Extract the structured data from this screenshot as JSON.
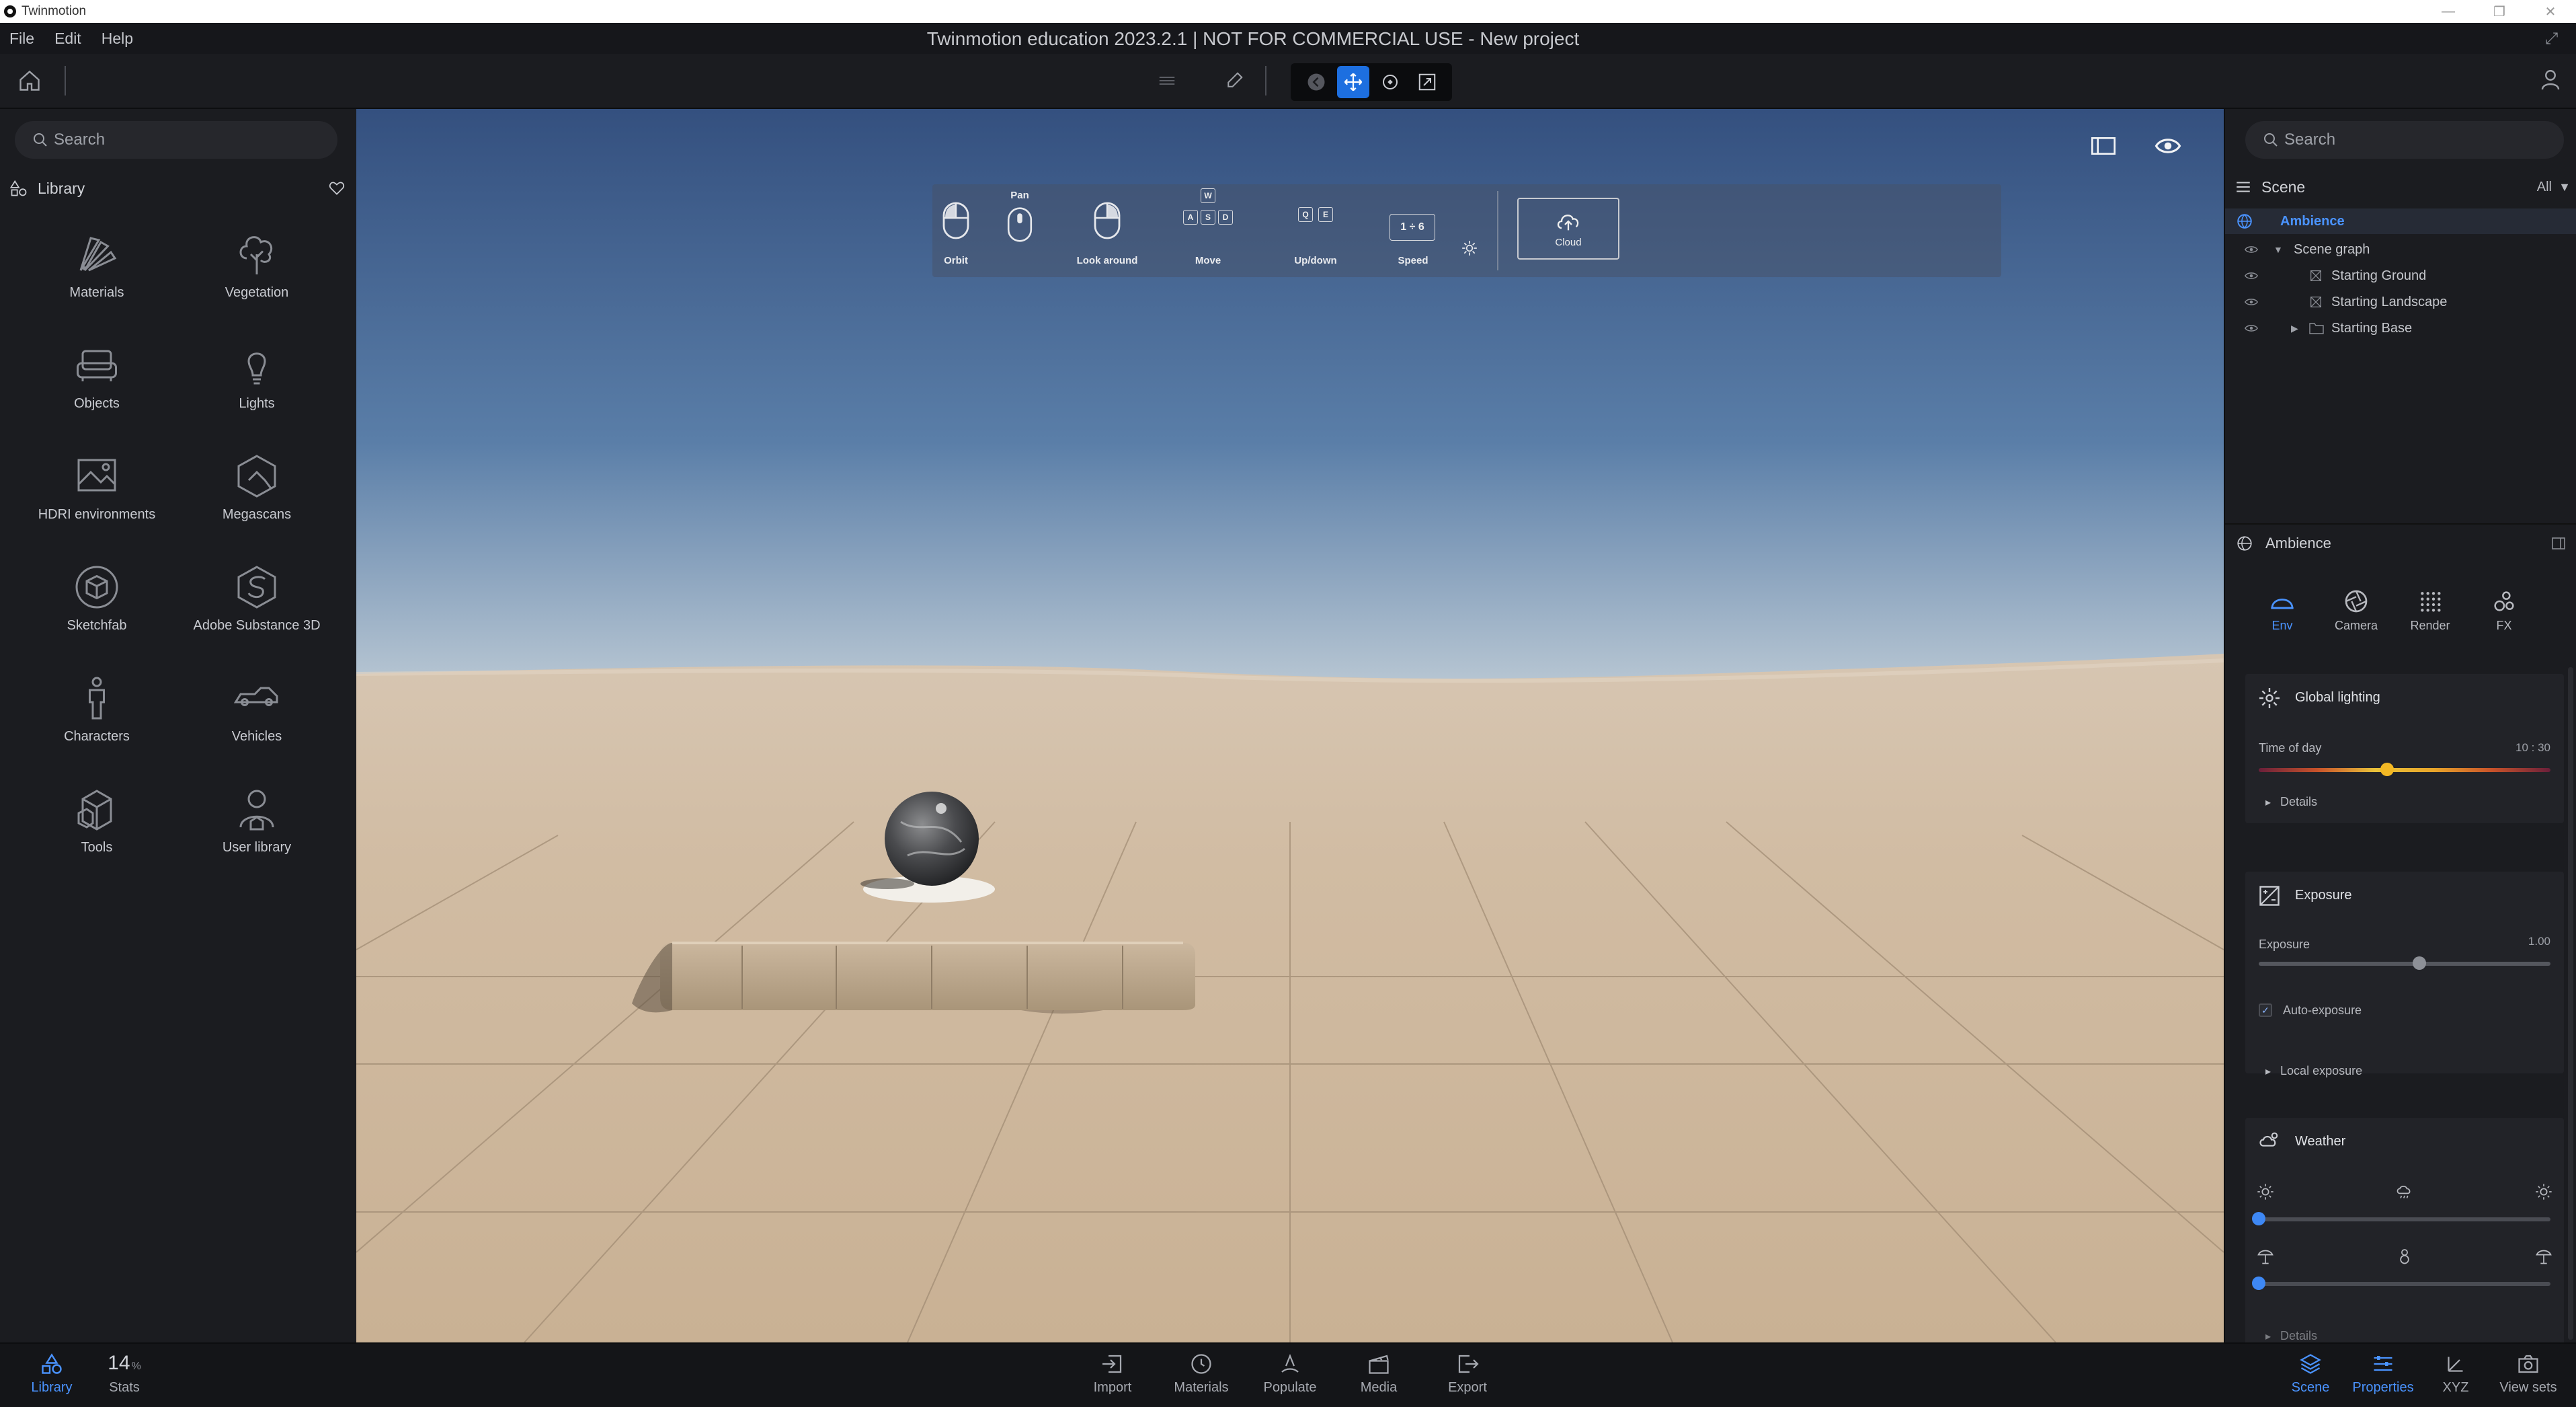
{
  "os": {
    "app_name": "Twinmotion"
  },
  "app": {
    "menus": [
      "File",
      "Edit",
      "Help"
    ],
    "title": "Twinmotion education 2023.2.1 | NOT FOR COMMERCIAL USE - New project"
  },
  "left_panel": {
    "search_placeholder": "Search",
    "library_label": "Library",
    "items": [
      {
        "label": "Materials",
        "icon": "materials-icon"
      },
      {
        "label": "Vegetation",
        "icon": "tree-icon"
      },
      {
        "label": "Objects",
        "icon": "sofa-icon"
      },
      {
        "label": "Lights",
        "icon": "bulb-icon"
      },
      {
        "label": "HDRI environments",
        "icon": "hdri-icon"
      },
      {
        "label": "Megascans",
        "icon": "megascans-icon"
      },
      {
        "label": "Sketchfab",
        "icon": "sketchfab-icon"
      },
      {
        "label": "Adobe Substance 3D",
        "icon": "substance-icon"
      },
      {
        "label": "Characters",
        "icon": "person-icon"
      },
      {
        "label": "Vehicles",
        "icon": "car-icon"
      },
      {
        "label": "Tools",
        "icon": "cubes-icon"
      },
      {
        "label": "User library",
        "icon": "user-library-icon"
      }
    ]
  },
  "nav_help": {
    "orbit": "Orbit",
    "pan": "Pan",
    "look_around": "Look around",
    "move": "Move",
    "updown": "Up/down",
    "speed": "Speed",
    "speed_keys": "1 ÷ 6",
    "cloud": "Cloud",
    "keys_move": [
      "W",
      "A",
      "S",
      "D"
    ],
    "keys_updown": [
      "Q",
      "E"
    ]
  },
  "right_panel": {
    "search_placeholder": "Search",
    "scene_label": "Scene",
    "filter": "All",
    "tree": [
      {
        "label": "Ambience"
      },
      {
        "label": "Scene graph"
      },
      {
        "label": "Starting Ground"
      },
      {
        "label": "Starting Landscape"
      },
      {
        "label": "Starting Base"
      }
    ],
    "ambience_label": "Ambience",
    "tabs": [
      {
        "label": "Env"
      },
      {
        "label": "Camera"
      },
      {
        "label": "Render"
      },
      {
        "label": "FX"
      }
    ],
    "global_lighting": {
      "title": "Global lighting",
      "time_label": "Time of day",
      "time_value": "10 : 30",
      "time_fraction": 0.44,
      "details": "Details"
    },
    "exposure": {
      "title": "Exposure",
      "label": "Exposure",
      "value": "1.00",
      "fraction": 0.55,
      "auto_label": "Auto-exposure",
      "local_label": "Local exposure"
    },
    "weather": {
      "title": "Weather",
      "weather_fraction": 0.0,
      "season_fraction": 0.0,
      "details": "Details"
    }
  },
  "bottom_bar": {
    "library": "Library",
    "stats_value": "14",
    "stats_unit": "%",
    "stats": "Stats",
    "center": [
      "Import",
      "Materials",
      "Populate",
      "Media",
      "Export"
    ],
    "right": [
      "Scene",
      "Properties",
      "XYZ",
      "View sets"
    ]
  },
  "colors": {
    "accent": "#4a93ff",
    "active_button": "#1d6fe0",
    "panel_bg": "#1b1c20",
    "sky_top": "#3b5a8a",
    "sand": "#cdb79c"
  }
}
